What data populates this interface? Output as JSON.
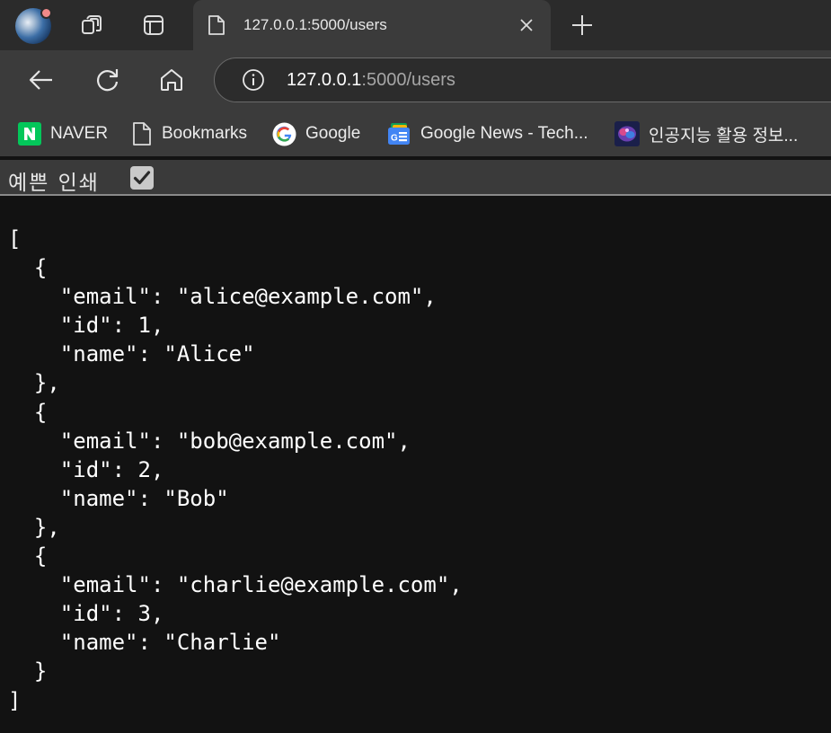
{
  "tab": {
    "title": "127.0.0.1:5000/users"
  },
  "address_bar": {
    "url_host": "127.0.0.1",
    "url_rest": ":5000/users"
  },
  "bookmarks": [
    {
      "label": "NAVER",
      "icon": "naver-icon"
    },
    {
      "label": "Bookmarks",
      "icon": "document-icon"
    },
    {
      "label": "Google",
      "icon": "google-icon"
    },
    {
      "label": "Google News - Tech...",
      "icon": "google-news-icon"
    },
    {
      "label": "인공지능 활용 정보...",
      "icon": "brain-icon"
    }
  ],
  "pretty_print": {
    "label": "예쁜 인쇄",
    "checked": true
  },
  "json_text": "[\n  {\n    \"email\": \"alice@example.com\",\n    \"id\": 1,\n    \"name\": \"Alice\"\n  },\n  {\n    \"email\": \"bob@example.com\",\n    \"id\": 2,\n    \"name\": \"Bob\"\n  },\n  {\n    \"email\": \"charlie@example.com\",\n    \"id\": 3,\n    \"name\": \"Charlie\"\n  }\n]",
  "colors": {
    "tabstrip_bg": "#2b2b2b",
    "toolbar_bg": "#3b3b3b",
    "page_bg": "#121212",
    "naver_green": "#03c75a"
  }
}
